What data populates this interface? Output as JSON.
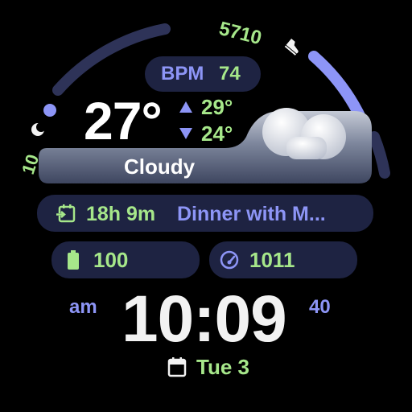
{
  "colors": {
    "accent": "#8d95f6",
    "green": "#a6e78a",
    "pill_bg": "#1e2342",
    "track": "#3a3f66",
    "text_white": "#f2f2f2"
  },
  "steps": {
    "value": "5710",
    "icon": "shoe-icon",
    "progress_fraction": 0.35
  },
  "left_complication": {
    "value": "10",
    "icon": "moon-icon"
  },
  "heart_rate": {
    "label": "BPM",
    "value": "74"
  },
  "weather": {
    "temperature": "27°",
    "high": "29°",
    "low": "24°",
    "condition": "Cloudy",
    "icon": "cloud-icon"
  },
  "agenda": {
    "time": "18h 9m",
    "title": "Dinner with M...",
    "icon": "calendar-arrow-icon"
  },
  "battery": {
    "value": "100",
    "icon": "battery-icon"
  },
  "pressure": {
    "value": "1011",
    "icon": "gauge-icon"
  },
  "clock": {
    "ampm": "am",
    "time": "10:09",
    "seconds": "40"
  },
  "date": {
    "text": "Tue 3",
    "icon": "calendar-icon"
  }
}
